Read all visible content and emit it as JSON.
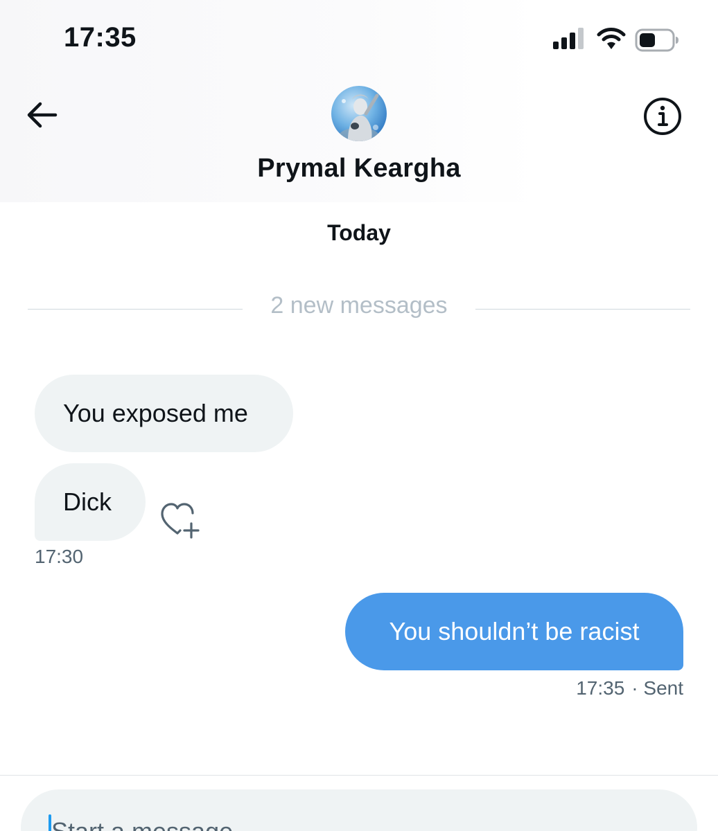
{
  "status_bar": {
    "time": "17:35",
    "icons": [
      "cellular-signal-icon",
      "wifi-icon",
      "battery-icon"
    ]
  },
  "header": {
    "back_icon": "arrow-left-icon",
    "info_icon": "info-circle-icon",
    "contact_name": "Prymal Keargha"
  },
  "conversation": {
    "day_label": "Today",
    "new_messages_label": "2 new messages",
    "incoming": [
      {
        "text": "You exposed me"
      },
      {
        "text": "Dick"
      }
    ],
    "incoming_time": "17:30",
    "outgoing": [
      {
        "text": "You shouldn’t be racist"
      }
    ],
    "outgoing_time": "17:35",
    "outgoing_status": "· Sent"
  },
  "composer": {
    "placeholder": "Start a message"
  },
  "colors": {
    "accent_blue": "#4a99e9",
    "incoming_bubble": "#eff3f4",
    "secondary_text": "#536471",
    "divider": "#cfd9de"
  }
}
